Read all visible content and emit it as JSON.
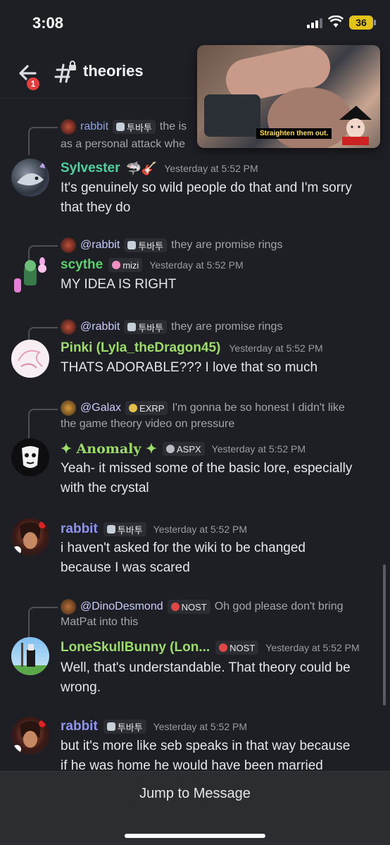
{
  "status": {
    "time": "3:08",
    "battery": "36"
  },
  "header": {
    "channel": "theories",
    "back_badge": "1"
  },
  "pip": {
    "caption": "Straighten them out."
  },
  "messages": [
    {
      "reply": {
        "author": "rabbit",
        "tag": "투바투",
        "text": "the is",
        "text2": "as a personal attack whe"
      },
      "author": "Sylvester",
      "author_color": "#4fd1a0",
      "deco": "🦈🎸",
      "time": "Yesterday at 5:52 PM",
      "lines": [
        "It's genuinely so wild people do that and I'm sorry",
        "that they do"
      ]
    },
    {
      "reply": {
        "author": "@rabbit",
        "tag": "투바투",
        "text": "they are promise rings"
      },
      "author": "scythe",
      "author_color": "#59d36b",
      "tag": "mizi",
      "time": "Yesterday at 5:52 PM",
      "lines": [
        "MY IDEA IS RIGHT"
      ]
    },
    {
      "reply": {
        "author": "@rabbit",
        "tag": "투바투",
        "text": "they are promise rings"
      },
      "author": "Pinki (Lyla_theDragon45)",
      "author_color": "#9ddc6a",
      "time": "Yesterday at 5:52 PM",
      "lines": [
        "THATS ADORABLE??? I love that so much"
      ]
    },
    {
      "reply": {
        "author": "@Galax",
        "tag": "EXRP",
        "text": "I'm gonna be so honest I didn't like",
        "text2": "the game theory video on pressure"
      },
      "author": "✦ Anomaly ✦",
      "author_color": "#9ddc6a",
      "tag": "ASPX",
      "time": "Yesterday at 5:52 PM",
      "lines": [
        "Yeah- it missed some of the basic lore, especially",
        "with the crystal"
      ]
    },
    {
      "author": "rabbit",
      "author_color": "#8e93f0",
      "tag": "투바투",
      "time": "Yesterday at 5:52 PM",
      "lines": [
        "i haven't asked for the wiki to be changed",
        "because I was scared"
      ]
    },
    {
      "reply": {
        "author": "@DinoDesmond",
        "tag": "NOST",
        "text": "Oh god please don't bring",
        "text2": "MatPat into this"
      },
      "author": "LoneSkullBunny (Lon...",
      "author_color": "#9ddc6a",
      "tag": "NOST",
      "time": "Yesterday at 5:52 PM",
      "lines": [
        "Well, that's understandable. That theory could be",
        "wrong."
      ]
    },
    {
      "author": "rabbit",
      "author_color": "#8e93f0",
      "tag": "투바투",
      "time": "Yesterday at 5:52 PM",
      "lines": [
        "but it's more like seb speaks in that way because",
        "if he was home he would have been married"
      ]
    }
  ],
  "footer": {
    "jump": "Jump to Message"
  },
  "colors": {
    "background": "#1e1f24",
    "mention": "#c9cdfb",
    "badge_red": "#e23e3e"
  }
}
